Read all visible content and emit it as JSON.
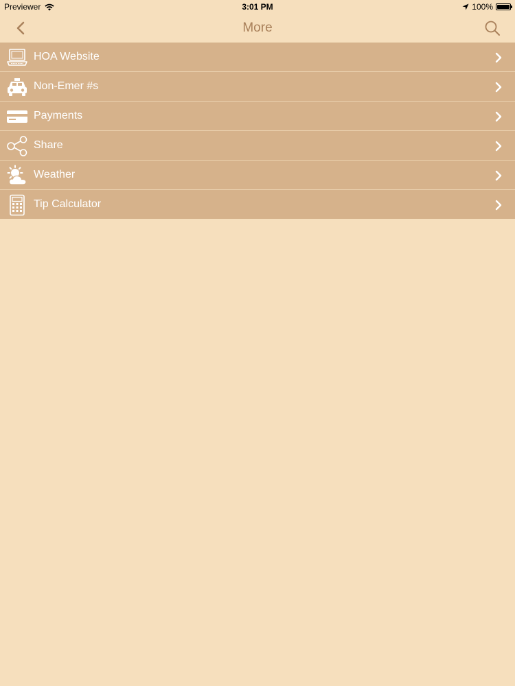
{
  "status_bar": {
    "carrier": "Previewer",
    "time": "3:01 PM",
    "battery": "100%",
    "battery_level": 1.0,
    "icons": [
      "wifi-icon",
      "location-arrow-icon",
      "battery-icon"
    ]
  },
  "nav": {
    "title": "More",
    "back_icon": "chevron-left-icon",
    "search_icon": "search-icon"
  },
  "menu": {
    "items": [
      {
        "label": "HOA Website",
        "icon": "laptop-icon"
      },
      {
        "label": "Non-Emer #s",
        "icon": "car-icon"
      },
      {
        "label": "Payments",
        "icon": "credit-card-icon"
      },
      {
        "label": "Share",
        "icon": "share-icon"
      },
      {
        "label": "Weather",
        "icon": "weather-icon"
      },
      {
        "label": "Tip Calculator",
        "icon": "calculator-icon"
      }
    ]
  },
  "colors": {
    "background": "#f6dfbd",
    "row_background": "#d6b28b",
    "row_divider": "#ecd3b1",
    "nav_accent": "#a9805a",
    "row_text": "#ffffff"
  }
}
